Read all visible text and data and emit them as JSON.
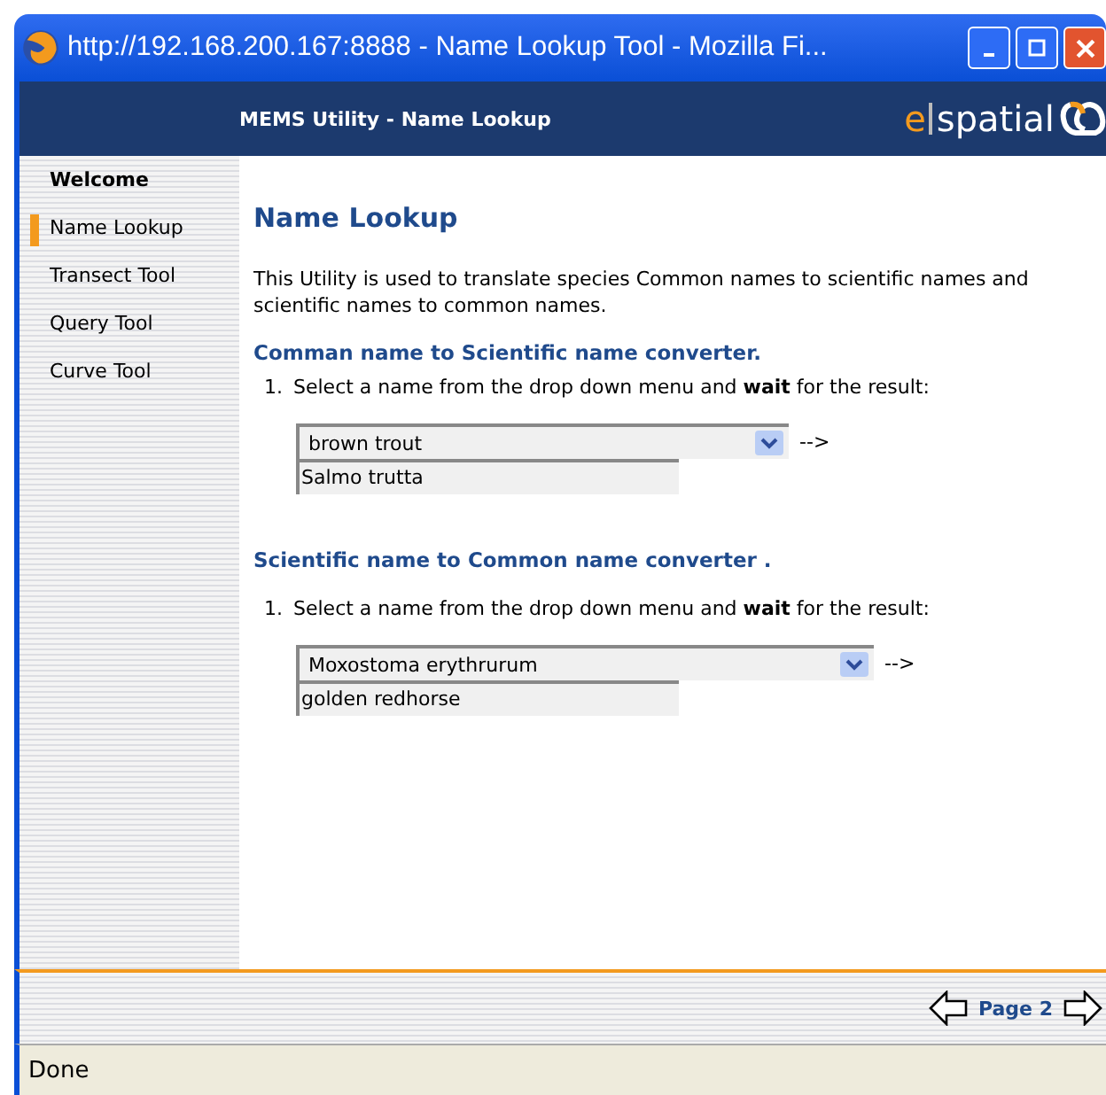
{
  "window": {
    "title": "http://192.168.200.167:8888 - Name Lookup Tool - Mozilla Fi..."
  },
  "header": {
    "title": "MEMS Utility - Name Lookup",
    "logo_prefix": "e",
    "logo_text": "spatial"
  },
  "sidebar": {
    "heading": "Welcome",
    "items": [
      {
        "label": "Name Lookup",
        "selected": true
      },
      {
        "label": "Transect Tool",
        "selected": false
      },
      {
        "label": "Query Tool",
        "selected": false
      },
      {
        "label": "Curve Tool",
        "selected": false
      }
    ]
  },
  "content": {
    "title": "Name Lookup",
    "intro": "This Utility is used to translate species Common names to scientific names and scientific names to common names.",
    "sections": [
      {
        "heading": "Comman name to Scientific name converter.",
        "step_number": "1.",
        "step": "Select a name from the drop down menu and **wait** for the result:",
        "select_value": "brown trout",
        "arrow": "-->",
        "result": "Salmo trutta"
      },
      {
        "heading": "Scientific name to Common name converter .",
        "step_number": "1.",
        "step": "Select a name from the drop down menu and **wait** for the result:",
        "select_value": "Moxostoma erythrurum",
        "arrow": "-->",
        "result": "golden redhorse"
      }
    ]
  },
  "footer": {
    "page_label": "Page 2"
  },
  "status_bar": {
    "text": "Done"
  }
}
